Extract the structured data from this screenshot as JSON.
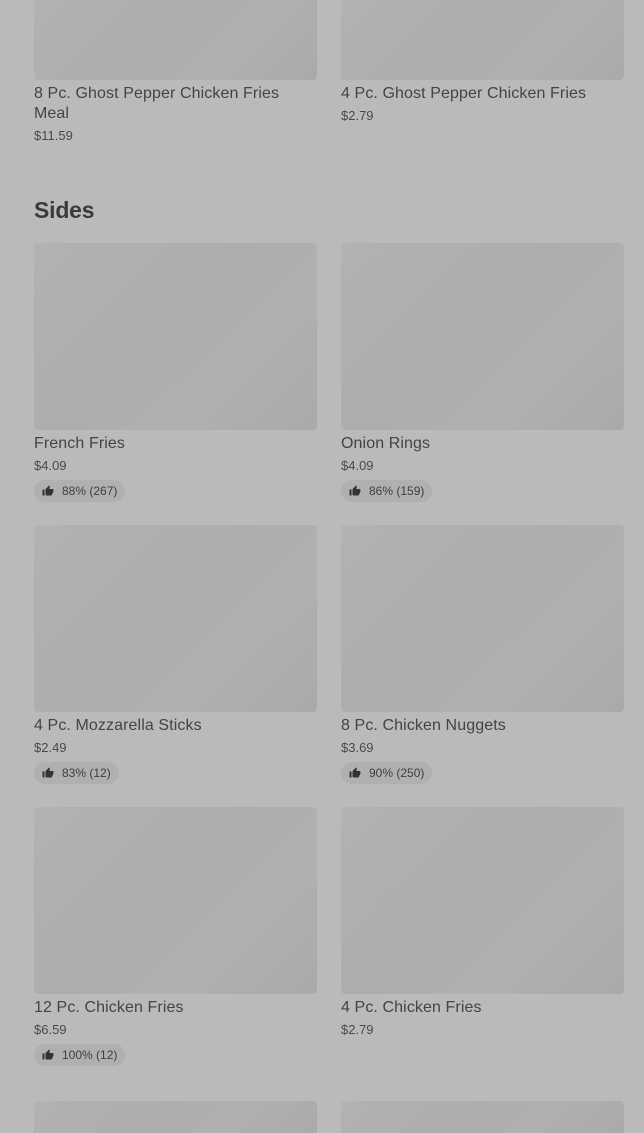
{
  "top_items": [
    {
      "name": "8 Pc. Ghost Pepper Chicken Fries Meal",
      "price": "$11.59"
    },
    {
      "name": "4 Pc. Ghost Pepper Chicken Fries",
      "price": "$2.79"
    }
  ],
  "sides": {
    "title": "Sides",
    "items": [
      {
        "name": "French Fries",
        "price": "$4.09",
        "rating": "88% (267)"
      },
      {
        "name": "Onion Rings",
        "price": "$4.09",
        "rating": "86% (159)"
      },
      {
        "name": "4 Pc. Mozzarella Sticks",
        "price": "$2.49",
        "rating": "83% (12)"
      },
      {
        "name": "8 Pc. Chicken Nuggets",
        "price": "$3.69",
        "rating": "90% (250)"
      },
      {
        "name": "12 Pc. Chicken Fries",
        "price": "$6.59",
        "rating": "100% (12)"
      },
      {
        "name": "4 Pc. Chicken Fries",
        "price": "$2.79"
      }
    ]
  },
  "icons": {
    "rating": "thumbs-up-icon"
  },
  "colors": {
    "background": "#bababa",
    "image_placeholder": "#afafaf",
    "rating_pill": "#b0b0b0",
    "text": "#3c3c3c"
  }
}
